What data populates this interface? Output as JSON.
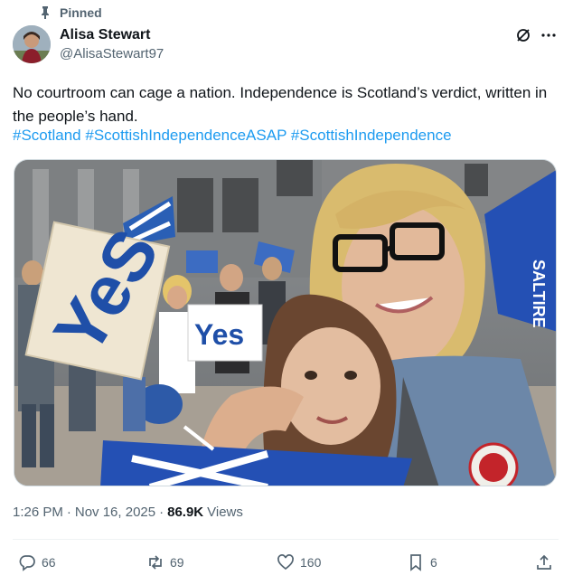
{
  "pinned_label": "Pinned",
  "author": {
    "display_name": "Alisa Stewart",
    "handle": "@AlisaStewart97"
  },
  "tweet": {
    "text": "No courtroom can cage a nation. Independence is Scotland’s verdict, written in the people’s hand.",
    "hashtags": [
      "#Scotland",
      "#ScottishIndependenceASAP",
      "#ScottishIndependence"
    ]
  },
  "photo": {
    "signs": [
      "YeS",
      "Yes"
    ]
  },
  "meta": {
    "time": "1:26 PM",
    "separator": "·",
    "date": "Nov 16, 2025",
    "views_count": "86.9K",
    "views_label": "Views"
  },
  "actions": {
    "replies": "66",
    "reposts": "69",
    "likes": "160",
    "bookmarks": "6"
  },
  "colors": {
    "accent": "#1d9bf0",
    "text": "#0f1419",
    "secondary": "#536471",
    "saltire_blue": "#1f4fa8"
  },
  "icons": [
    "pin-icon",
    "grok-icon",
    "more-icon",
    "reply-icon",
    "repost-icon",
    "like-icon",
    "bookmark-icon",
    "share-icon"
  ]
}
